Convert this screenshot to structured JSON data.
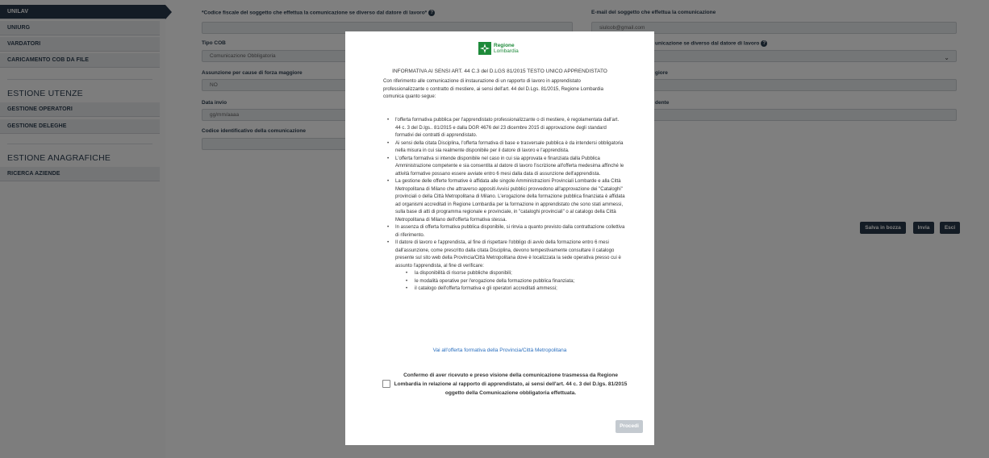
{
  "sidebar": {
    "items_top": [
      "UNILAV",
      "UNIURG",
      "VARDATORI",
      "CARICAMENTO COB DA FILE"
    ],
    "section_utenze": "ESTIONE UTENZE",
    "items_utenze": [
      "GESTIONE OPERATORI",
      "GESTIONE DELEGHE"
    ],
    "section_anagrafiche": "ESTIONE ANAGRAFICHE",
    "items_anagrafiche": [
      "RICERCA AZIENDE"
    ]
  },
  "form": {
    "cf_label": "*Codice fiscale del soggetto che effettua la comunicazione se diverso dal datore di lavoro*",
    "email_label": "E-mail del soggetto che effettua la comunicazione",
    "email_value": "siulcob@gmail.com",
    "tipo_cob_label": "Tipo COB",
    "tipo_cob_value": "Comunicazione Obbligatoria",
    "right2_label": "unicazione se diverso dal datore di lavoro",
    "forza_label": "Assunzione per cause di forza maggiore",
    "forza_value": "NO",
    "right3_label": "giore",
    "data_invio_label": "Data invio",
    "data_invio_placeholder": "gg/mm/aaaa",
    "right4_label": "dente",
    "codice_label": "Codice identificativo della comunicazione"
  },
  "actions": {
    "save_draft": "Salva in bozza",
    "send": "Invia",
    "exit": "Esci"
  },
  "modal": {
    "logo_line1": "Regione",
    "logo_line2": "Lombardia",
    "title": "INFORMATIVA AI SENSI ART. 44 C.3 del D.LGS 81/2015 TESTO UNICO APPRENDISTATO",
    "intro": "Con riferimento alle comunicazione di instaurazione di un rapporto di lavoro in apprendistato professionalizzante o contratto di mestiere, ai sensi dell'art. 44 del D.Lgs. 81/2015, Regione Lombardia comunica quanto segue:",
    "bullets": [
      "l'offerta formativa pubblica per l'apprendistato professionalizzante o di mestiere, è regolamentata dall'art. 44 c. 3 del D.lgs.. 81/2015 e dalla DGR 4676 del 23 dicembre 2015 di approvazione degli standard formativi dei contratti di apprendistato.",
      "Ai sensi della citata Disciplina, l'offerta formativa di base e trasversale pubblica è da intendersi obbligatoria nella misura in cui sia realmente disponibile per il datore di lavoro e l'apprendista.",
      "L'offerta formativa si intende disponibile nel caso in cui sia approvata e finanziata dalla Pubblica Amministrazione competente e sia consentita al datore di lavoro l'iscrizione all'offerta medesima affinché le attività formative possano essere avviate entro 6 mesi dalla data di assunzione dell'apprendista.",
      "La gestione delle offerte formative è affidata alle singole Amministrazioni Provinciali Lombarde e alla Città Metropolitana di Milano che attraverso appositi Avvisi pubblici provvedono all'approvazione dei \"Cataloghi\" provinciali o della Città Metropolitana di Milano. L'erogazione della formazione pubblica finanziata è affidata ad organismi accreditati in Regione Lombardia per la formazione in apprendistato che sono stati ammessi, sulla base di atti di programma regionale e provinciale, in \"cataloghi provinciali\" o al catalogo della Città Metropolitana di Milano dell'offerta formativa stessa.",
      "In assenza di offerta formativa pubblica disponibile, si rinvia a quanto previsto dalla contrattazione collettiva di riferimento.",
      "Il datore di lavoro e l'apprendista, al fine di rispettare l'obbligo di avvio della formazione entro 6 mesi dall'assunzione, come prescritto dalla citata Disciplina, devono tempestivamente consultare il catalogo presente sul sito web della Provincia/Città Metropolitana dove è localizzata la sede operativa presso cui è assunto l'apprendista, al fine di verificare:"
    ],
    "sub_bullets": [
      "la disponibilità di risorse pubbliche disponibili;",
      "le modalità operative per l'erogazione della formazione pubblica finanziata;",
      "il catalogo dell'offerta formativa e gli operatori accreditati ammessi;"
    ],
    "link": "Vai all'offerta formativa della Provincia/Città Metropolitana",
    "confirm": "Confermo di aver ricevuto e preso visione della comunicazione trasmessa da Regione Lombardia in relazione al rapporto di apprendistato, ai sensi dell'art. 44 c. 3 del D.lgs. 81/2015 oggetto della Comunicazione obbligatoria effettuata.",
    "proceed": "Procedi"
  }
}
